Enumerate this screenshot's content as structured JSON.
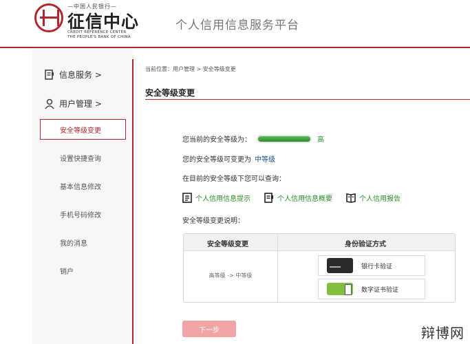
{
  "header": {
    "logo_top": "—中国人民银行—",
    "logo_main": "征信中心",
    "logo_en_line1": "CREDIT REFERENCE CENTER",
    "logo_en_line2": "THE PEOPLE'S BANK OF CHINA",
    "platform_title": "个人信用信息服务平台",
    "accent_color": "#b3262b"
  },
  "sidebar": {
    "heads": [
      {
        "label": "信息服务 >",
        "icon": "document-icon"
      },
      {
        "label": "用户管理 >",
        "icon": "user-icon"
      }
    ],
    "items": [
      {
        "label": "安全等级变更",
        "active": true
      },
      {
        "label": "设置快捷查询"
      },
      {
        "label": "基本信息修改"
      },
      {
        "label": "手机号码修改"
      },
      {
        "label": "我的消息"
      },
      {
        "label": "销户"
      }
    ]
  },
  "main": {
    "breadcrumb": "当前位置：用户管理 > 安全等级变更",
    "title": "安全等级变更",
    "current_level_label": "您当前的安全等级为：",
    "current_level_value": "高",
    "level_fraction": 1.0,
    "changeable_label": "您的安全等级可变更为",
    "changeable_value": "中等级",
    "query_label": "在目前的安全等级下您可以查询：",
    "links": [
      {
        "label": "个人信用信息提示",
        "icon": "info-document-icon"
      },
      {
        "label": "个人信用信息概要",
        "icon": "summary-document-icon"
      },
      {
        "label": "个人信用报告",
        "icon": "report-book-icon"
      }
    ],
    "explain_label": "安全等级变更说明：",
    "table": {
      "col1_header": "安全等级变更",
      "col2_header": "身份验证方式",
      "change": "高等级 -> 中等级",
      "methods": [
        {
          "label": "银行卡验证",
          "icon": "bank-card-icon"
        },
        {
          "label": "数字证书验证",
          "icon": "digital-certificate-icon"
        }
      ]
    },
    "next_button": "下一步"
  },
  "watermark": "辩博网"
}
